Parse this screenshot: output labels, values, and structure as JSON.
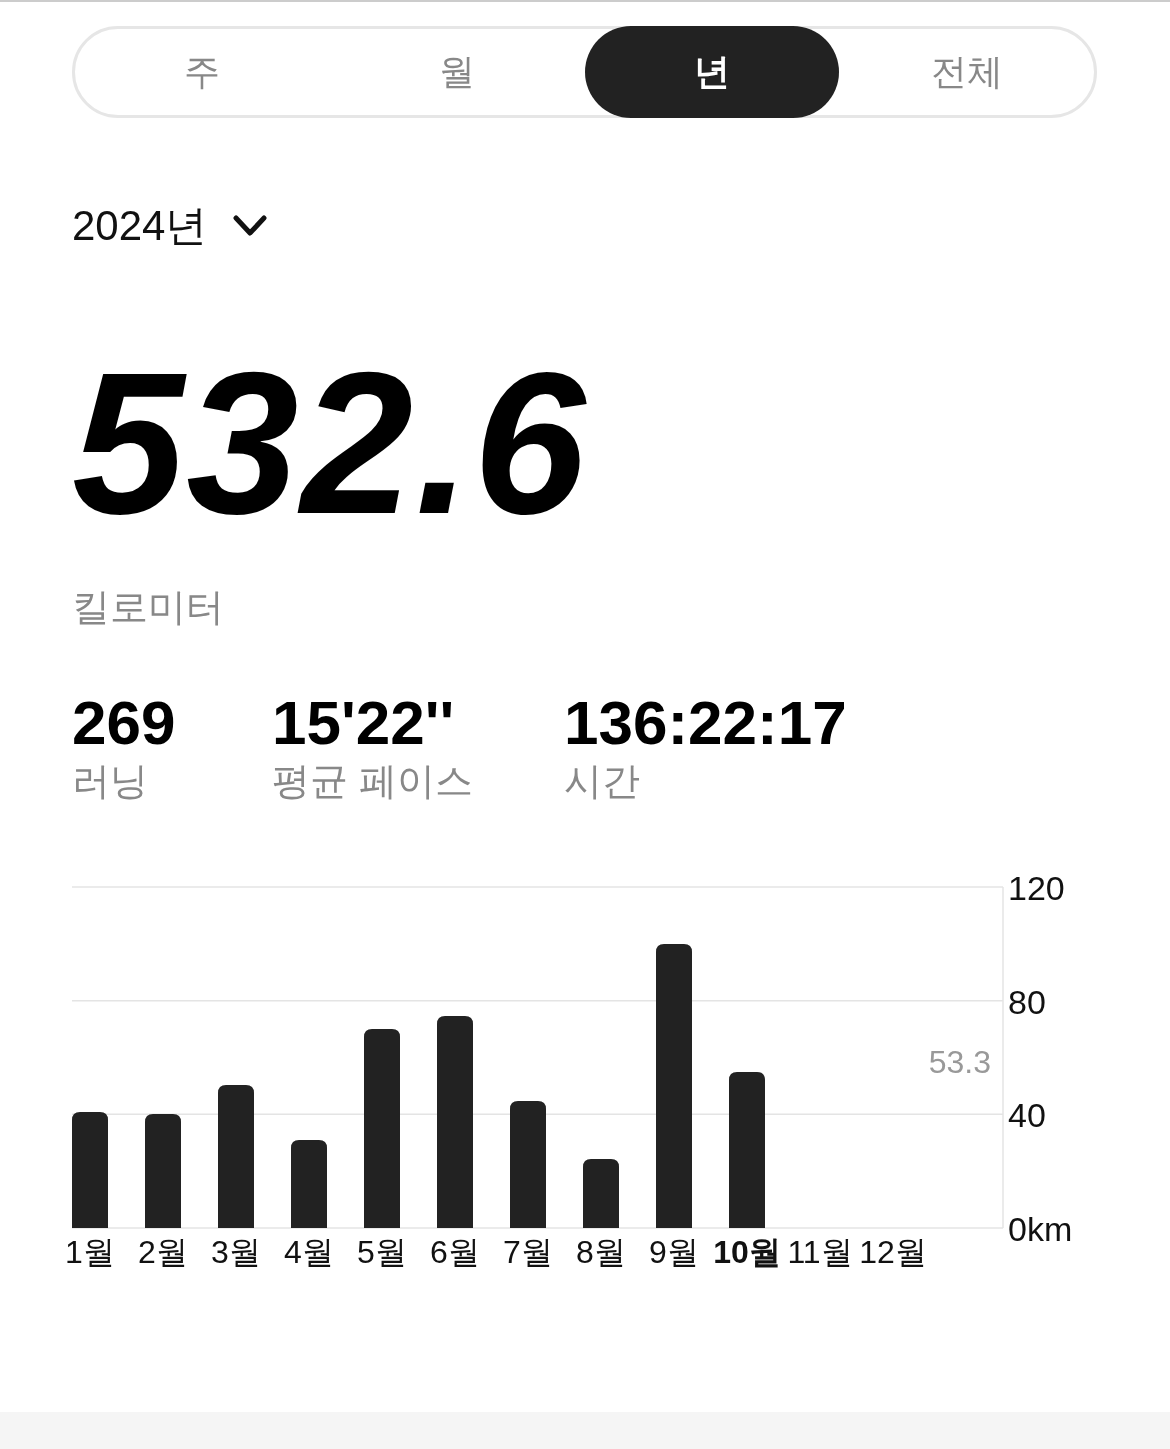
{
  "tabs": [
    {
      "label": "주",
      "selected": false
    },
    {
      "label": "월",
      "selected": false
    },
    {
      "label": "년",
      "selected": true
    },
    {
      "label": "전체",
      "selected": false
    }
  ],
  "year_picker": {
    "label": "2024년"
  },
  "total": {
    "value": "532.6",
    "unit": "킬로미터"
  },
  "stats": [
    {
      "value": "269",
      "label": "러닝"
    },
    {
      "value": "15'22''",
      "label": "평균 페이스"
    },
    {
      "value": "136:22:17",
      "label": "시간"
    }
  ],
  "chart": {
    "month_highlight": [
      false,
      false,
      false,
      false,
      false,
      false,
      false,
      false,
      false,
      true,
      false,
      false
    ],
    "chart_data": {
      "type": "bar",
      "categories": [
        "1월",
        "2월",
        "3월",
        "4월",
        "5월",
        "6월",
        "7월",
        "8월",
        "9월",
        "10월",
        "11월",
        "12월"
      ],
      "values": [
        40.8,
        40.1,
        50.3,
        31.0,
        70.0,
        74.6,
        44.7,
        24.3,
        99.9,
        54.9,
        null,
        null
      ],
      "ylim": [
        0,
        120
      ],
      "yticks": [
        {
          "value": 0,
          "label": "0km"
        },
        40,
        80,
        120
      ],
      "ref_lines": [
        {
          "label": "53.3"
        }
      ]
    }
  }
}
